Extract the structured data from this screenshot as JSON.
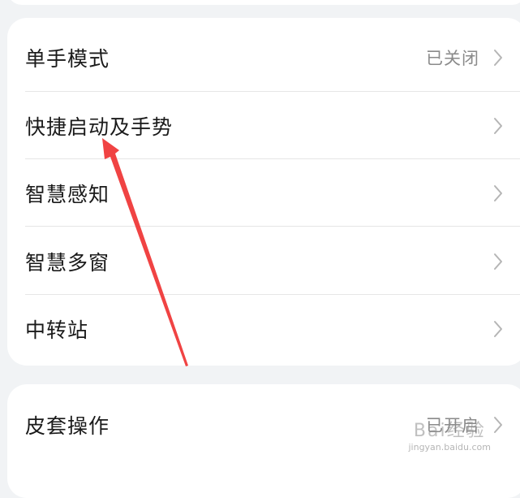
{
  "settings": {
    "rows": [
      {
        "label": "单手模式",
        "value": "已关闭"
      },
      {
        "label": "快捷启动及手势",
        "value": ""
      },
      {
        "label": "智慧感知",
        "value": ""
      },
      {
        "label": "智慧多窗",
        "value": ""
      },
      {
        "label": "中转站",
        "value": ""
      }
    ],
    "bottom_rows": [
      {
        "label": "皮套操作",
        "value": "已开启"
      }
    ]
  },
  "annotation": {
    "color": "#f04343",
    "icon": "red-arrow"
  },
  "watermark": {
    "logo": "Bai经验",
    "url": "jingyan.baidu.com"
  }
}
